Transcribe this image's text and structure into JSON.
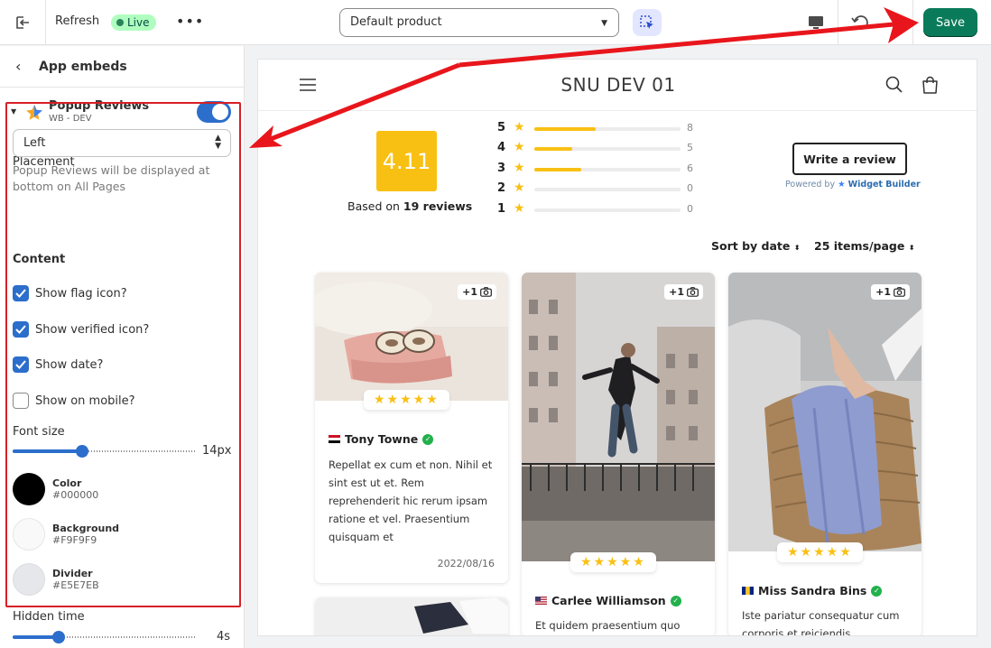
{
  "topbar": {
    "title": "Refresh",
    "status_badge": "Live",
    "more_label": "•••",
    "product_select": "Default product",
    "save_label": "Save"
  },
  "sidebar": {
    "title": "App embeds",
    "embed": {
      "name": "Popup Reviews",
      "subtitle": "WB - DEV",
      "enabled": true
    },
    "placement": {
      "label": "Placement",
      "value": "Left",
      "help": "Popup Reviews will be displayed at bottom on All Pages"
    },
    "content_heading": "Content",
    "options": [
      {
        "label": "Show flag icon?",
        "checked": true
      },
      {
        "label": "Show verified icon?",
        "checked": true
      },
      {
        "label": "Show date?",
        "checked": true
      },
      {
        "label": "Show on mobile?",
        "checked": false
      }
    ],
    "font_size": {
      "label": "Font size",
      "value": "14px",
      "level": 0.38
    },
    "colors": [
      {
        "name": "Color",
        "hex": "#000000"
      },
      {
        "name": "Background",
        "hex": "#F9F9F9"
      },
      {
        "name": "Divider",
        "hex": "#E5E7EB"
      }
    ],
    "hidden_time": {
      "label": "Hidden time",
      "value": "4s",
      "level": 0.25
    }
  },
  "store": {
    "name": "SNU DEV 01",
    "rating": "4.11",
    "based_prefix": "Based on",
    "based_count": "19 reviews",
    "distribution": [
      {
        "stars": "5",
        "count": "8",
        "fraction": 0.42
      },
      {
        "stars": "4",
        "count": "5",
        "fraction": 0.26
      },
      {
        "stars": "3",
        "count": "6",
        "fraction": 0.32
      },
      {
        "stars": "2",
        "count": "0",
        "fraction": 0
      },
      {
        "stars": "1",
        "count": "0",
        "fraction": 0
      }
    ],
    "write_review": "Write a review",
    "powered_by": "Powered by",
    "widget_builder": "Widget Builder",
    "sort_label": "Sort by date",
    "items_label": "25 items/page"
  },
  "reviews": [
    {
      "photo_count": "+1",
      "stars": "★★★★★",
      "name": "Tony Towne",
      "flag": "egypt",
      "body": "Repellat ex cum et non. Nihil et sint est ut et. Rem reprehenderit hic rerum ipsam ratione et vel. Praesentium quisquam et",
      "date": "2022/08/16"
    },
    {
      "photo_count": "+1",
      "stars": "★★★★★",
      "name": "Carlee Williamson",
      "flag": "usa",
      "body": "Et quidem praesentium quo"
    },
    {
      "photo_count": "+1",
      "stars": "★★★★★",
      "name": "Miss Sandra Bins",
      "flag": "barbados",
      "body": "Iste pariatur consequatur cum corporis et reiciendis"
    }
  ],
  "colors": {
    "accent": "#2c6ecb",
    "save": "#0a7b5a",
    "star": "#f9c014",
    "annotation": "#e8161c"
  }
}
